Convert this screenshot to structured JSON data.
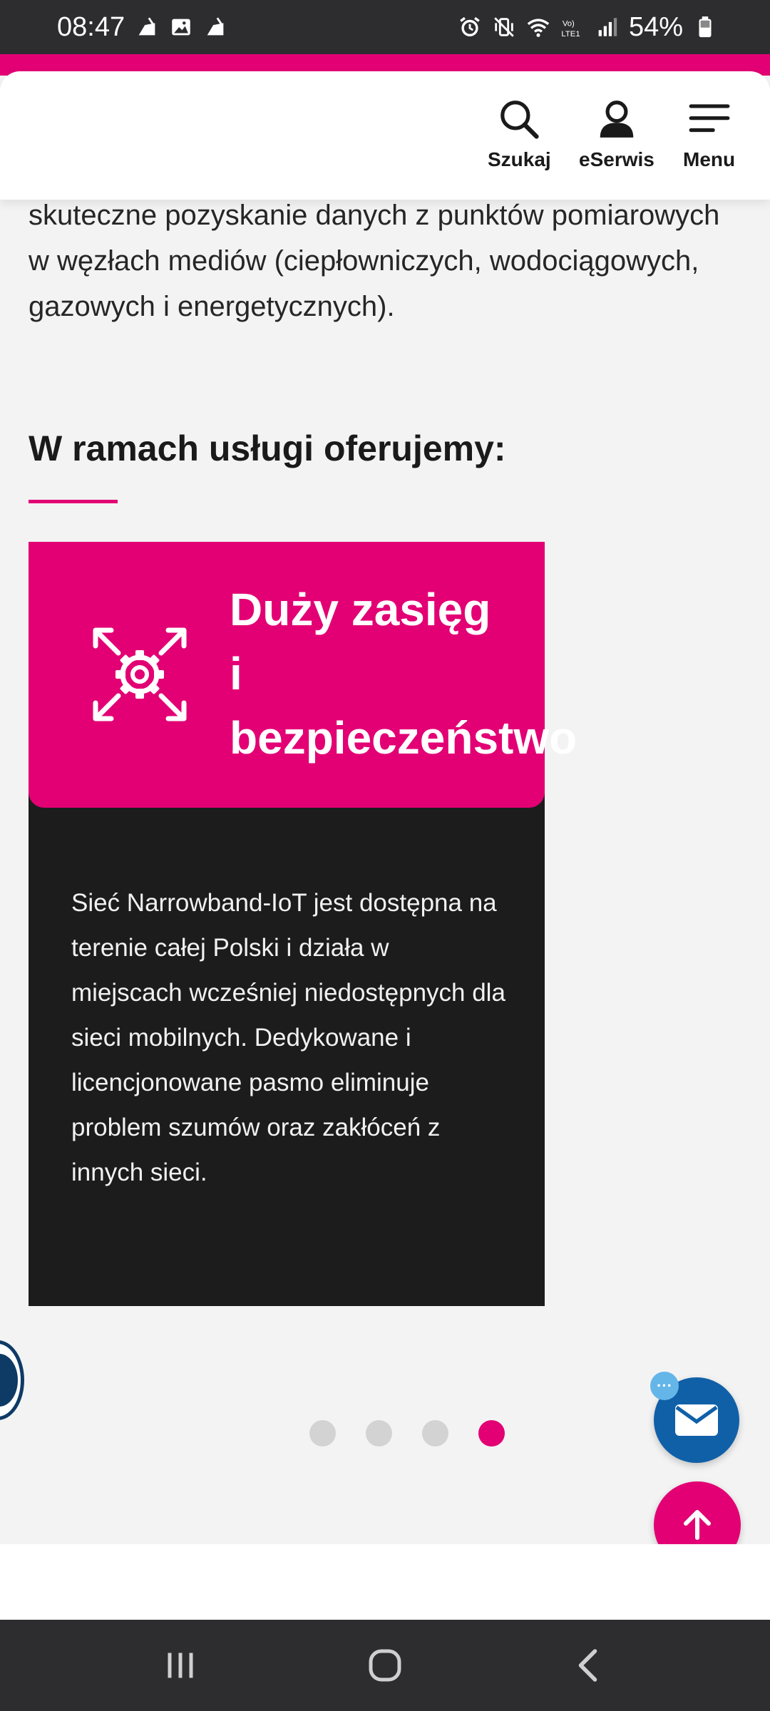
{
  "status_bar": {
    "time": "08:47",
    "battery": "54%",
    "left_icons": [
      "broom-icon",
      "image-icon",
      "broom-icon"
    ],
    "right_icons": [
      "alarm-icon",
      "vibrate-icon",
      "wifi-icon",
      "volte-icon",
      "signal-icon",
      "battery-icon"
    ]
  },
  "header": {
    "search_label": "Szukaj",
    "eserwis_label": "eSerwis",
    "menu_label": "Menu"
  },
  "content": {
    "intro_text": "skuteczne pozyskanie danych z punktów pomiarowych w węzłach mediów (ciepłowniczych, wodociągowych, gazowych i energetycznych).",
    "section_title": "W ramach usługi oferujemy:"
  },
  "card": {
    "title_line1": "Duży zasięg",
    "title_line2": "i",
    "title_line3": "bezpieczeństwo",
    "description": "Sieć Narrowband-IoT jest dostępna na terenie całej Polski i działa w miejscach wcześniej niedostępnych dla sieci mobilnych. Dedykowane i licencjonowane pasmo eliminuje problem szumów oraz zakłóceń z innych sieci."
  },
  "carousel": {
    "total_slides": 4,
    "active_slide": 4
  },
  "fab": {
    "badge_text": "···"
  },
  "colors": {
    "brand": "#e20074",
    "card_bg": "#1c1c1d",
    "mail_fab": "#1060a8"
  }
}
